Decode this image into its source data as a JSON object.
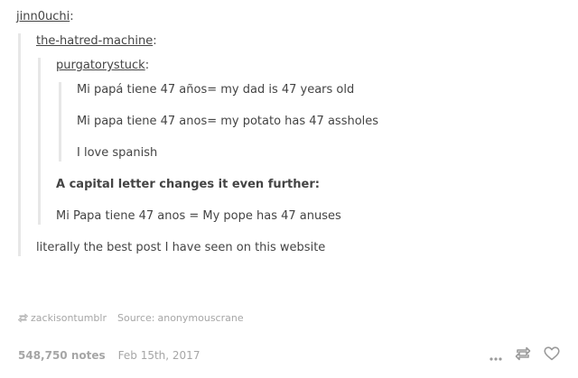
{
  "post": {
    "author": "jinn0uchi",
    "reblog1": {
      "author": "the-hatred-machine",
      "reblog2": {
        "author": "purgatorystuck",
        "paragraphs": [
          "Mi papá tiene 47 años= my dad is 47 years old",
          "Mi papa tiene 47 anos= my potato has 47 assholes",
          "I love spanish"
        ]
      },
      "paragraphs_bold": "A capital letter changes it even further:",
      "paragraph_after": "Mi Papa tiene 47 anos = My pope has 47 anuses"
    },
    "comment": "literally the best post I have seen on this website"
  },
  "meta": {
    "via": "zackisontumblr",
    "source_label": "Source:",
    "source": "anonymouscrane"
  },
  "footer": {
    "notes": "548,750 notes",
    "date": "Feb 15th, 2017"
  },
  "icons": {
    "reblog_small": "reblog-icon",
    "more": "more-icon",
    "reblog": "reblog-icon",
    "like": "heart-icon"
  }
}
